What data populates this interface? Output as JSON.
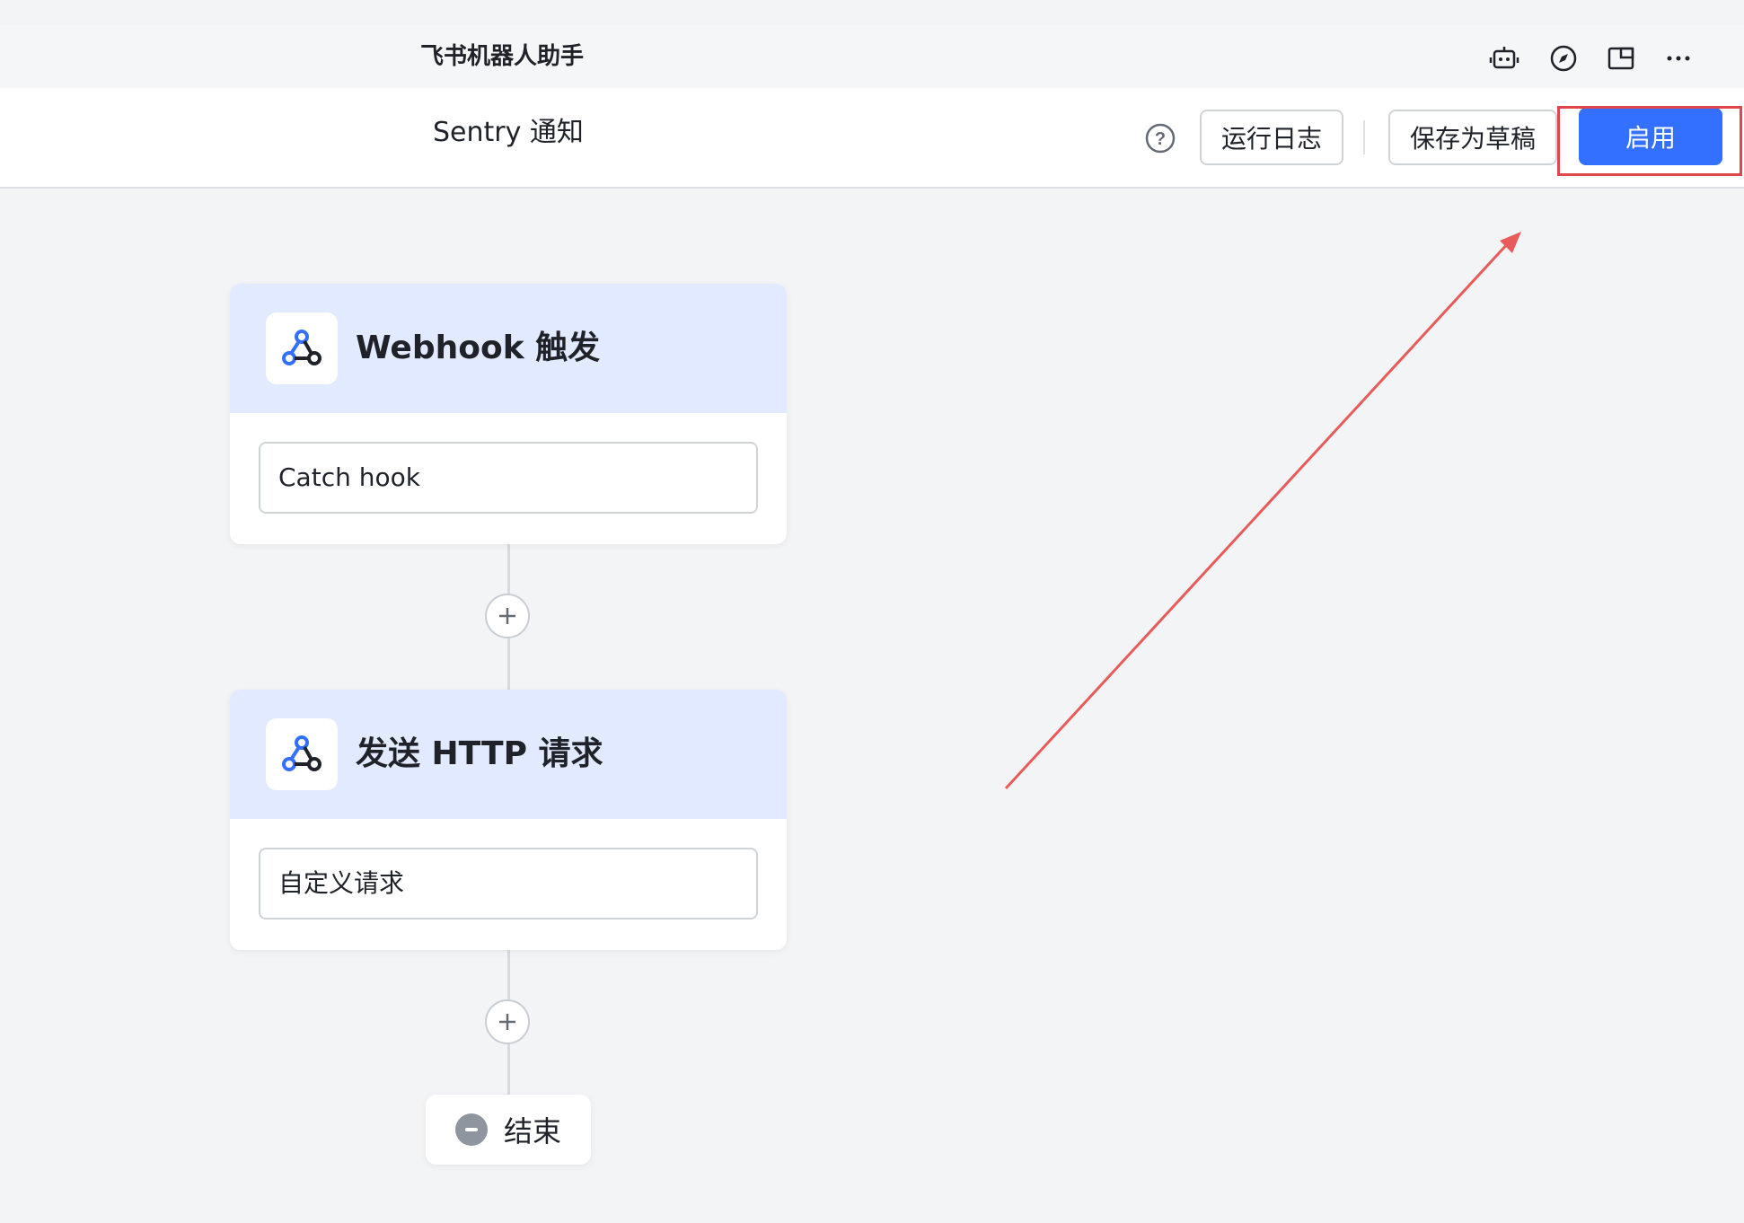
{
  "app": {
    "title": "飞书机器人助手",
    "icons": [
      "robot-icon",
      "compass-icon",
      "window-icon",
      "more-icon"
    ]
  },
  "toolbar": {
    "flow_name": "Sentry 通知",
    "help_icon": "help-icon",
    "run_log_label": "运行日志",
    "save_draft_label": "保存为草稿",
    "enable_label": "启用"
  },
  "flow": {
    "nodes": [
      {
        "title": "Webhook 触发",
        "icon": "webhook-icon",
        "field": "Catch hook"
      },
      {
        "title": "发送 HTTP 请求",
        "icon": "webhook-icon",
        "field": "自定义请求"
      }
    ],
    "end_label": "结束"
  },
  "colors": {
    "primary": "#3370ff",
    "node_header": "#e1eafe",
    "annotation": "#e0474c",
    "canvas": "#f3f4f6"
  }
}
